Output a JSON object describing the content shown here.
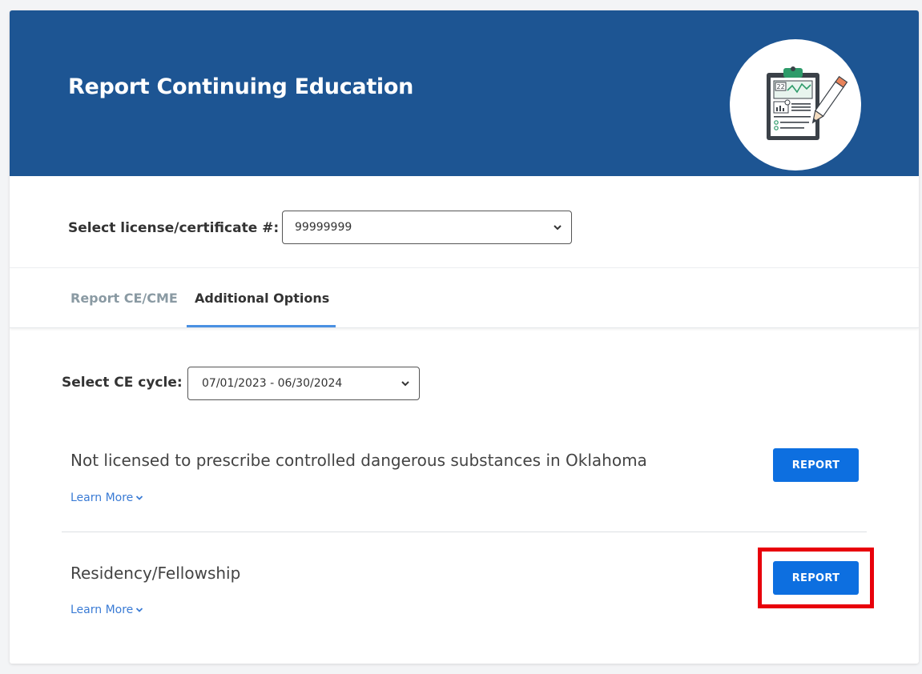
{
  "header": {
    "title": "Report Continuing Education",
    "logo_icon": "clipboard-chart-icon",
    "background_color": "#1d5593"
  },
  "license": {
    "label": "Select license/certificate #:",
    "selected": "99999999"
  },
  "tabs": [
    {
      "label": "Report CE/CME",
      "active": false
    },
    {
      "label": "Additional Options",
      "active": true
    }
  ],
  "cycle": {
    "label": "Select CE cycle:",
    "selected": "07/01/2023 - 06/30/2024"
  },
  "options": [
    {
      "title": "Not licensed to prescribe controlled dangerous substances in Oklahoma",
      "learn_more": "Learn More",
      "button_label": "REPORT"
    },
    {
      "title": "Residency/Fellowship",
      "learn_more": "Learn More",
      "button_label": "REPORT",
      "highlighted": true
    }
  ],
  "colors": {
    "accent": "#0d6fe0",
    "link": "#3a7bd5",
    "highlight": "#e8000b",
    "tab_underline": "#4a90e2"
  }
}
